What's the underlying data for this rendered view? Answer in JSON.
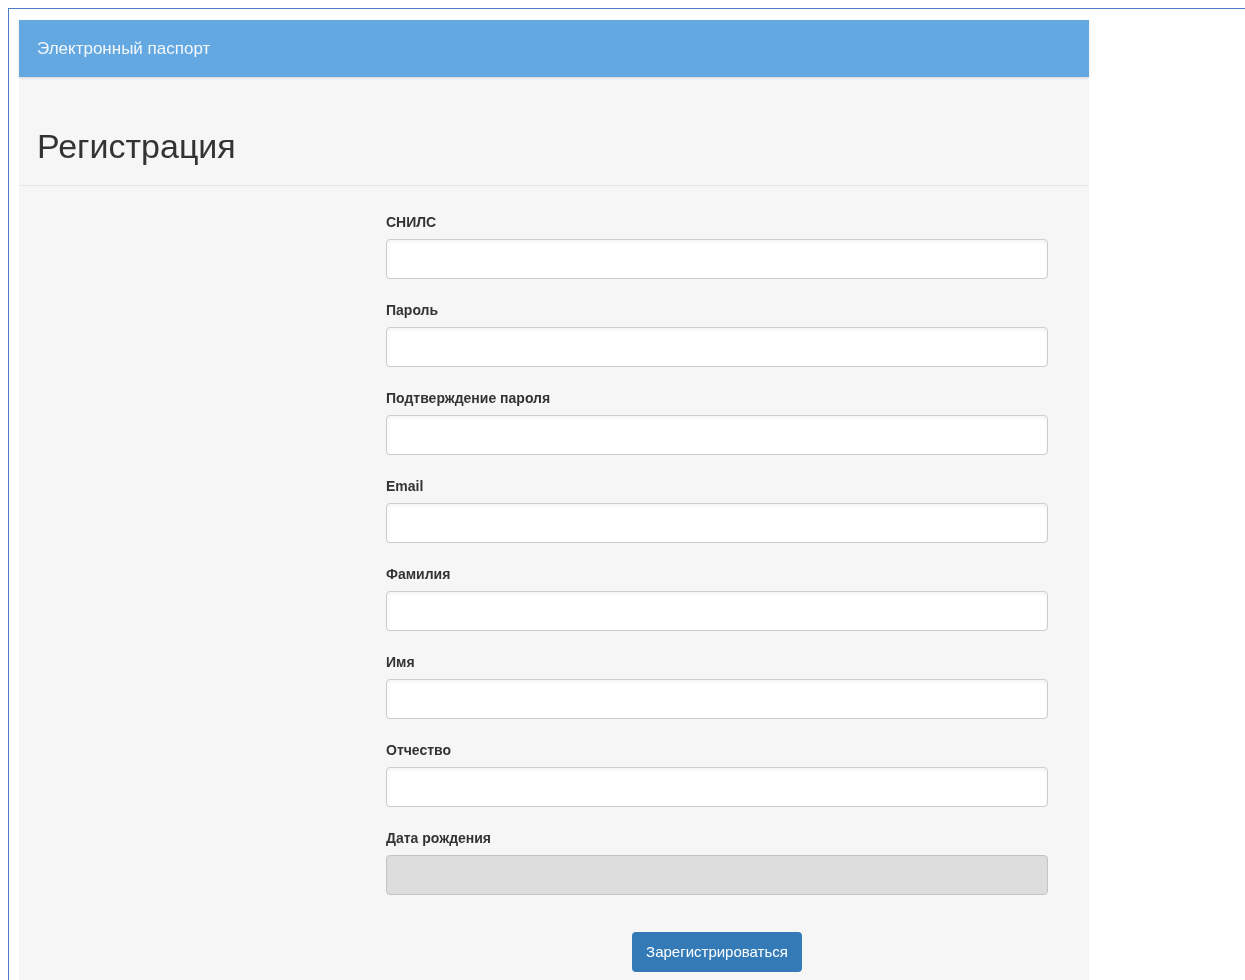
{
  "navbar": {
    "brand": "Электронный паспорт"
  },
  "page": {
    "title": "Регистрация"
  },
  "form": {
    "fields": [
      {
        "label": "СНИЛС",
        "disabled": false
      },
      {
        "label": "Пароль",
        "disabled": false
      },
      {
        "label": "Подтверждение пароля",
        "disabled": false
      },
      {
        "label": "Email",
        "disabled": false
      },
      {
        "label": "Фамилия",
        "disabled": false
      },
      {
        "label": "Имя",
        "disabled": false
      },
      {
        "label": "Отчество",
        "disabled": false
      },
      {
        "label": "Дата рождения",
        "disabled": true
      }
    ],
    "submit": "Зарегистрироваться"
  }
}
